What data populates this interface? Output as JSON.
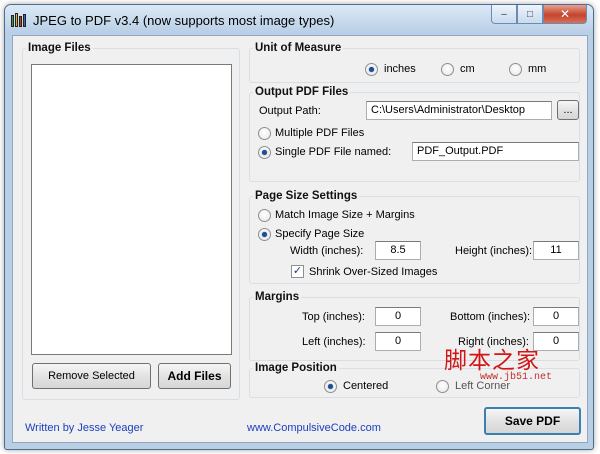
{
  "window": {
    "title": "JPEG to PDF  v3.4    (now supports most image types)"
  },
  "caption_buttons": {
    "minimize": "–",
    "maximize": "□",
    "close": "✕"
  },
  "image_files": {
    "group_label": "Image Files",
    "remove_label": "Remove Selected",
    "add_label": "Add Files"
  },
  "unit_of_measure": {
    "group_label": "Unit of Measure",
    "options": [
      {
        "label": "inches",
        "selected": true
      },
      {
        "label": "cm",
        "selected": false
      },
      {
        "label": "mm",
        "selected": false
      }
    ]
  },
  "output_pdf": {
    "group_label": "Output PDF Files",
    "path_label": "Output Path:",
    "path_value": "C:\\Users\\Administrator\\Desktop",
    "browse_label": "...",
    "multiple_label": "Multiple PDF Files",
    "single_label": "Single PDF File named:",
    "single_selected": true,
    "filename_value": "PDF_Output.PDF"
  },
  "page_size": {
    "group_label": "Page Size Settings",
    "match_label": "Match Image Size + Margins",
    "specify_label": "Specify Page Size",
    "specify_selected": true,
    "width_label": "Width (inches):",
    "width_value": "8.5",
    "height_label": "Height (inches):",
    "height_value": "11",
    "shrink_label": "Shrink Over-Sized Images",
    "shrink_checked": true
  },
  "margins": {
    "group_label": "Margins",
    "top_label": "Top (inches):",
    "top_value": "0",
    "bottom_label": "Bottom (inches):",
    "bottom_value": "0",
    "left_label": "Left (inches):",
    "left_value": "0",
    "right_label": "Right (inches):",
    "right_value": "0"
  },
  "image_position": {
    "group_label": "Image Position",
    "centered_label": "Centered",
    "centered_selected": true,
    "corner_label": "Left Corner"
  },
  "footer": {
    "author": "Written by Jesse Yeager",
    "website": "www.CompulsiveCode.com",
    "save_label": "Save PDF"
  },
  "watermark": {
    "chinese_text": "脚本之家",
    "url_text": "www.jb51.net"
  }
}
